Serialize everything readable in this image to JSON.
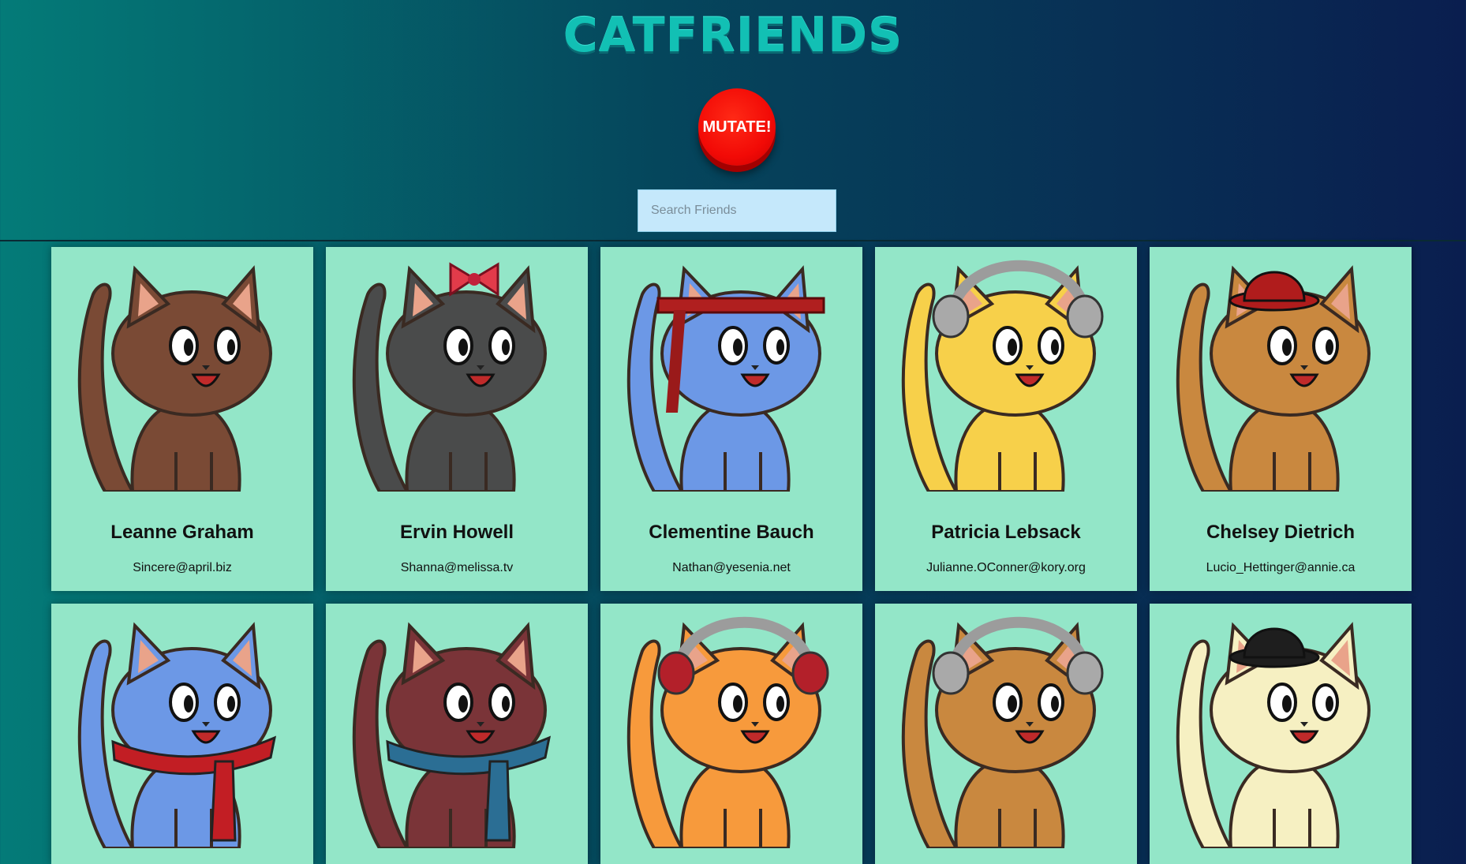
{
  "app": {
    "logo": "CATFRIENDS"
  },
  "controls": {
    "mutate_label": "MUTATE!",
    "search_placeholder": "Search Friends"
  },
  "cats": [
    {
      "name": "Leanne Graham",
      "email": "Sincere@april.biz",
      "body_color": "#7a4a35",
      "accessory": "none"
    },
    {
      "name": "Ervin Howell",
      "email": "Shanna@melissa.tv",
      "body_color": "#4a4b4b",
      "accessory": "bow"
    },
    {
      "name": "Clementine Bauch",
      "email": "Nathan@yesenia.net",
      "body_color": "#6c98e6",
      "accessory": "headband"
    },
    {
      "name": "Patricia Lebsack",
      "email": "Julianne.OConner@kory.org",
      "body_color": "#f7d04a",
      "accessory": "headphones"
    },
    {
      "name": "Chelsey Dietrich",
      "email": "Lucio_Hettinger@annie.ca",
      "body_color": "#c9883f",
      "accessory": "red-hat"
    },
    {
      "name": "",
      "email": "",
      "body_color": "#6c98e6",
      "accessory": "scarf-red"
    },
    {
      "name": "",
      "email": "",
      "body_color": "#7a3438",
      "accessory": "scarf-blue"
    },
    {
      "name": "",
      "email": "",
      "body_color": "#f79a3c",
      "accessory": "headphones-red"
    },
    {
      "name": "",
      "email": "",
      "body_color": "#c9883f",
      "accessory": "headphones"
    },
    {
      "name": "",
      "email": "",
      "body_color": "#f6f0c2",
      "accessory": "black-hat"
    }
  ]
}
